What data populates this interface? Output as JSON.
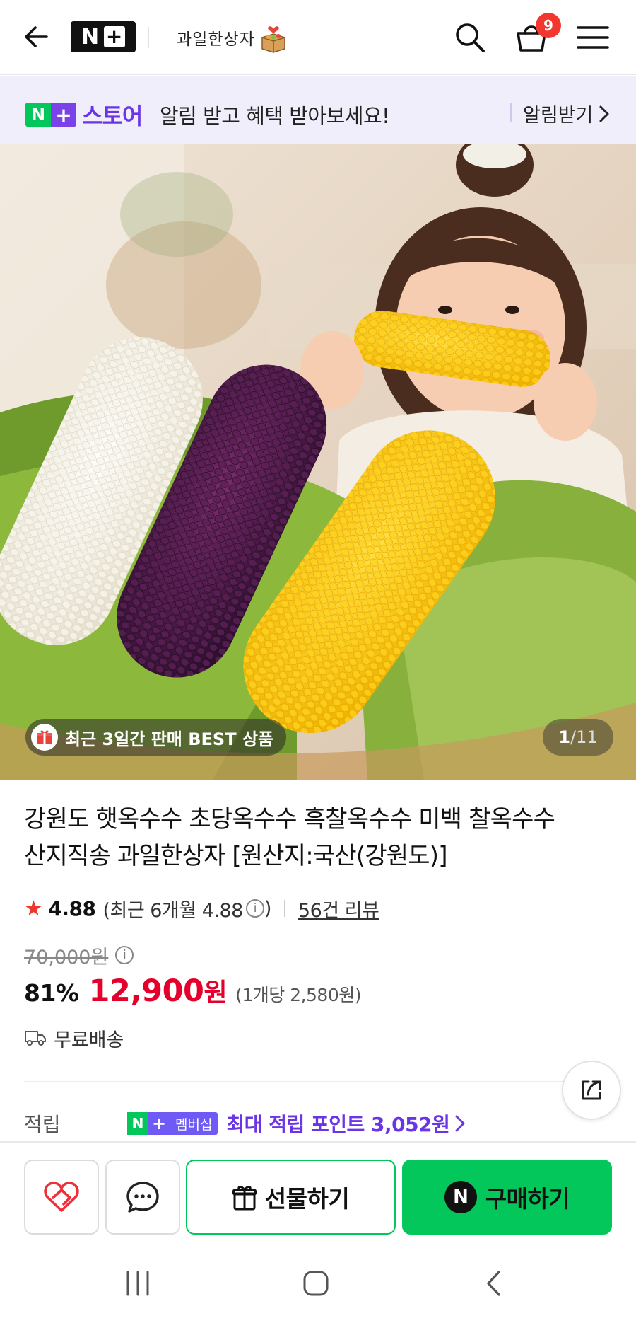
{
  "header": {
    "brand_n": "N",
    "brand_plus": "+",
    "store_logo_text": "과일한상자",
    "cart_count": "9",
    "icons": [
      "back-arrow-icon",
      "search-icon",
      "cart-icon",
      "menu-icon"
    ]
  },
  "notice": {
    "logo_n": "N",
    "logo_plus": "+",
    "store_name": "스토어",
    "message": "알림 받고 혜택 받아보세요!",
    "button_label": "알림받기"
  },
  "hero": {
    "badge_text": "최근 3일간 판매 BEST 상품",
    "current_index": "1",
    "separator": "/",
    "total": "11"
  },
  "product": {
    "title_line1": "강원도 햇옥수수 초당옥수수 흑찰옥수수 미백 찰옥수수",
    "title_line2": "산지직송 과일한상자 [원산지:국산(강원도)]",
    "rating": "4.88",
    "rating_recent": "(최근 6개월 4.88",
    "rating_close": ")",
    "review_link": "56건 리뷰",
    "original_price": "70,000원",
    "discount_rate": "81%",
    "price": "12,900",
    "price_unit": "원",
    "unit_price": "(1개당 2,580원)",
    "shipping": "무료배송"
  },
  "points": {
    "label": "적립",
    "badge_n": "N",
    "badge_plus": "+",
    "badge_text": "멤버십",
    "text": "최대 적립 포인트 3,052원"
  },
  "actions": {
    "gift_label": "선물하기",
    "buy_label": "구매하기",
    "buy_badge": "N"
  },
  "colors": {
    "naver_green": "#03c75a",
    "nplus_purple": "#6a35e6",
    "price_red": "#e4002b",
    "star_red": "#f0372c",
    "badge_red": "#f2372e",
    "notice_bg": "#f1eefc"
  }
}
